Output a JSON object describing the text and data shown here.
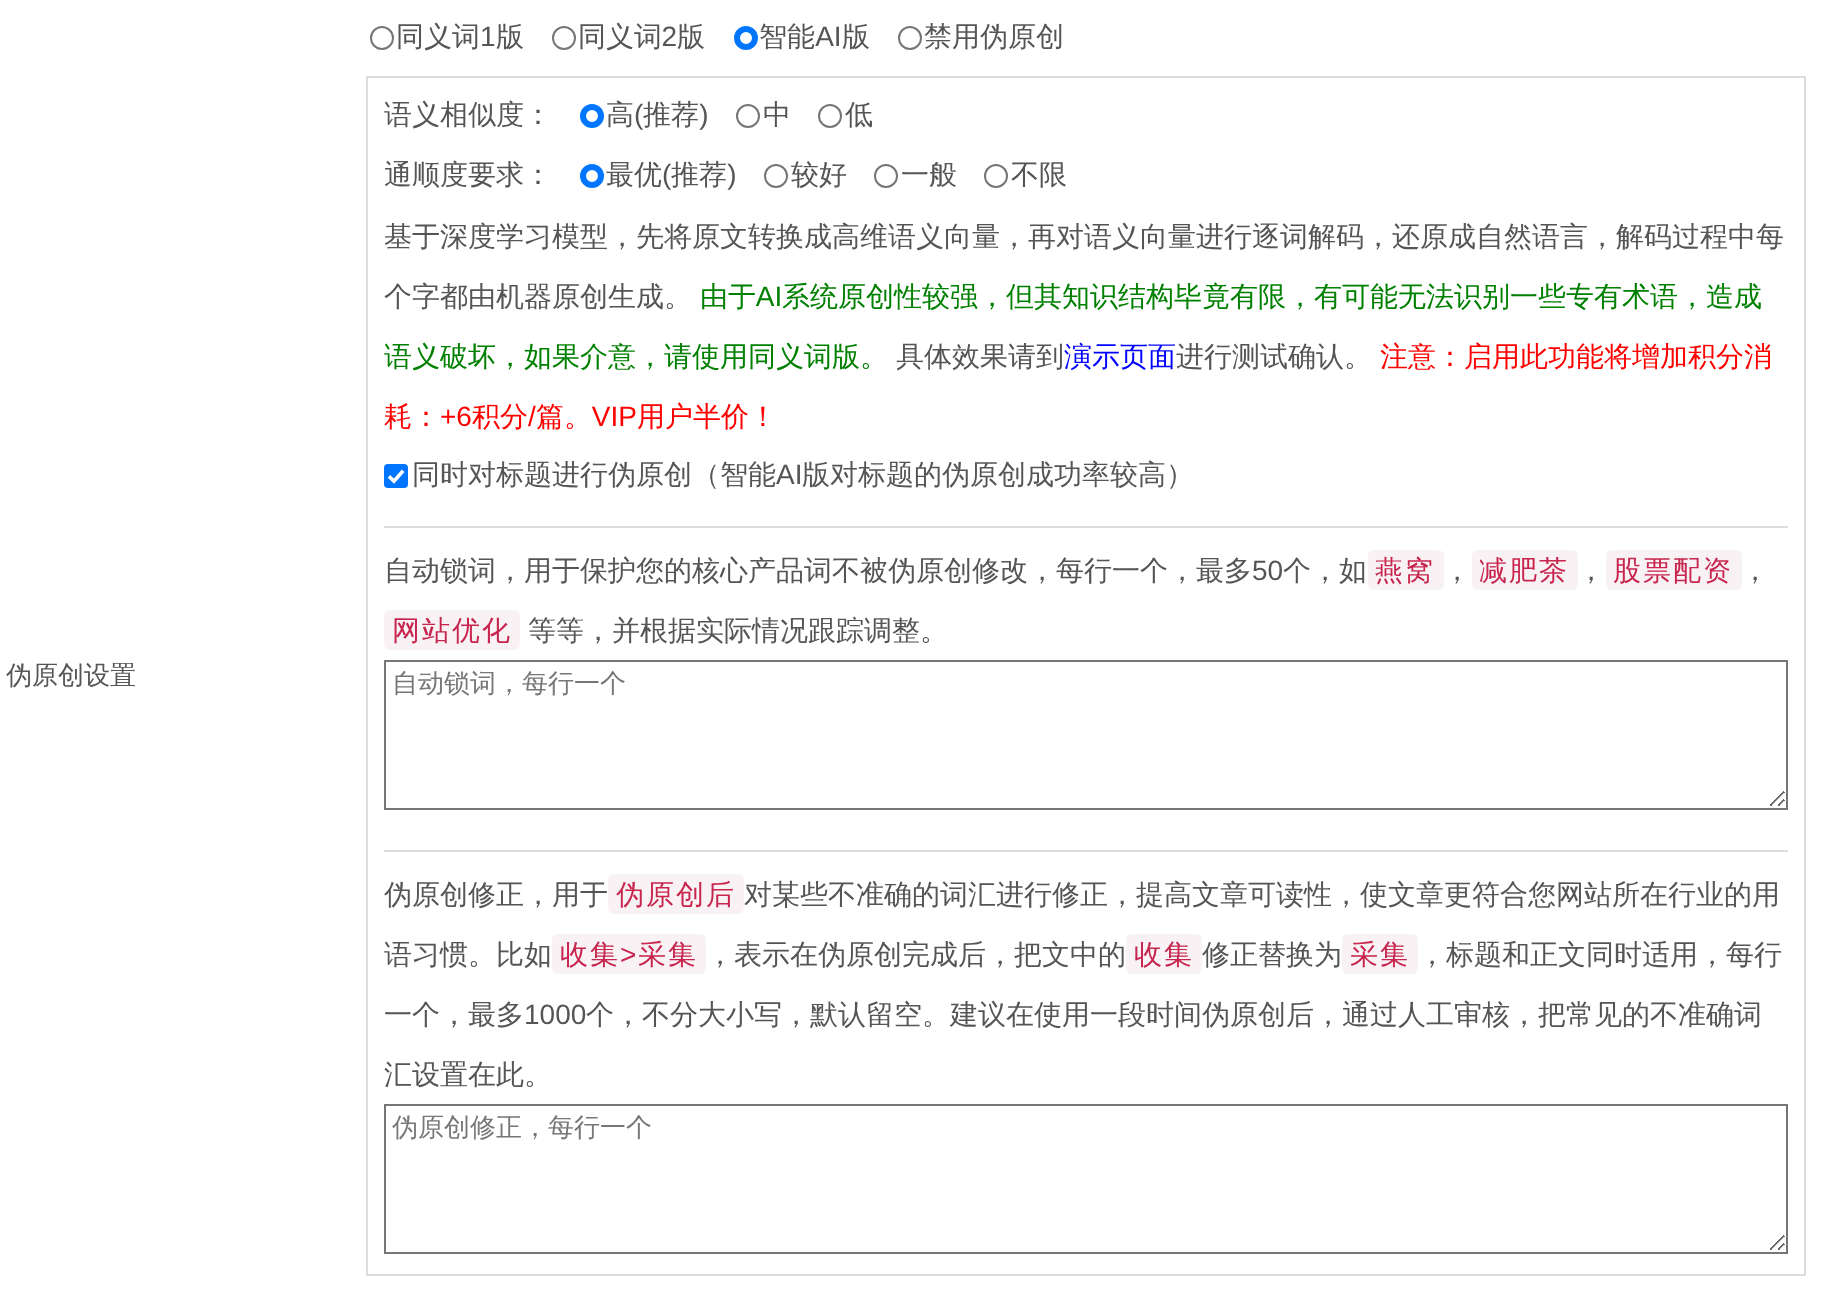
{
  "mode_options": [
    {
      "label": "同义词1版",
      "selected": false
    },
    {
      "label": "同义词2版",
      "selected": false
    },
    {
      "label": "智能AI版",
      "selected": true
    },
    {
      "label": "禁用伪原创",
      "selected": false
    }
  ],
  "section_label": "伪原创设置",
  "settings": [
    {
      "label": "语义相似度：",
      "options": [
        {
          "label": "高(推荐)",
          "selected": true
        },
        {
          "label": "中",
          "selected": false
        },
        {
          "label": "低",
          "selected": false
        }
      ]
    },
    {
      "label": "通顺度要求：",
      "options": [
        {
          "label": "最优(推荐)",
          "selected": true
        },
        {
          "label": "较好",
          "selected": false
        },
        {
          "label": "一般",
          "selected": false
        },
        {
          "label": "不限",
          "selected": false
        }
      ]
    }
  ],
  "ai_description": [
    {
      "kind": "plain",
      "text": "基于深度学习模型，先将原文转换成高维语义向量，再对语义向量进行逐词解码，还原成自然语言，解码过程中每个字都由机器原创生成。 "
    },
    {
      "kind": "note",
      "text": "由于AI系统原创性较强，但其知识结构毕竟有限，有可能无法识别一些专有术语，造成语义破坏，如果介意，请使用同义词版。"
    },
    {
      "kind": "plain",
      "text": " 具体效果请到"
    },
    {
      "kind": "link",
      "text": "演示页面"
    },
    {
      "kind": "plain",
      "text": "进行测试确认。 "
    },
    {
      "kind": "warning",
      "text": "注意：启用此功能将增加积分消耗：+6积分/篇。VIP用户半价！"
    }
  ],
  "title_option": {
    "label": "同时对标题进行伪原创（智能AI版对标题的伪原创成功率较高）",
    "checked": true
  },
  "lock_words": {
    "description": [
      {
        "kind": "plain",
        "text": "自动锁词，用于保护您的核心产品词不被伪原创修改，每行一个，最多50个，如"
      },
      {
        "kind": "tag",
        "text": "燕窝"
      },
      {
        "kind": "plain",
        "text": "，"
      },
      {
        "kind": "tag",
        "text": "减肥茶"
      },
      {
        "kind": "plain",
        "text": "，"
      },
      {
        "kind": "tag",
        "text": "股票配资"
      },
      {
        "kind": "plain",
        "text": "，"
      },
      {
        "kind": "tag",
        "text": "网站优化"
      },
      {
        "kind": "plain",
        "text": " 等等，并根据实际情况跟踪调整。"
      }
    ],
    "placeholder": "自动锁词，每行一个"
  },
  "correction": {
    "description": [
      {
        "kind": "plain",
        "text": "伪原创修正，用于"
      },
      {
        "kind": "tag",
        "text": "伪原创后"
      },
      {
        "kind": "plain",
        "text": "对某些不准确的词汇进行修正，提高文章可读性，使文章更符合您网站所在行业的用语习惯。比如"
      },
      {
        "kind": "tag",
        "text": "收集>采集"
      },
      {
        "kind": "plain",
        "text": "，表示在伪原创完成后，把文中的"
      },
      {
        "kind": "tag",
        "text": "收集"
      },
      {
        "kind": "plain",
        "text": "修正替换为"
      },
      {
        "kind": "tag",
        "text": "采集"
      },
      {
        "kind": "plain",
        "text": "，标题和正文同时适用，每行一个，最多1000个，不分大小写，默认留空。建议在使用一段时间伪原创后，通过人工审核，把常见的不准确词汇设置在此。"
      }
    ],
    "placeholder": "伪原创修正，每行一个"
  }
}
